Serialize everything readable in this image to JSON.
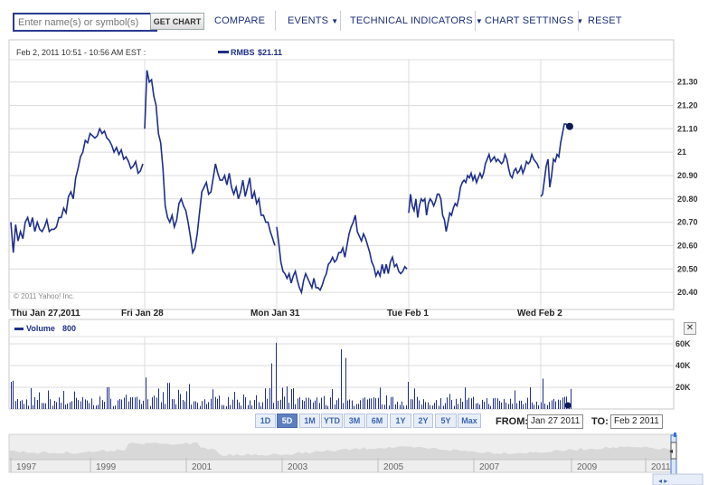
{
  "toolbar": {
    "search_placeholder": "Enter name(s) or symbol(s)",
    "get_chart": "GET CHART",
    "compare": "COMPARE",
    "events": "EVENTS",
    "technical_indicators": "TECHNICAL INDICATORS",
    "chart_settings": "CHART SETTINGS",
    "reset": "RESET",
    "dropdown_icon": "triangle-down-icon"
  },
  "header": {
    "datetime": "Feb 2, 2011 10:51 - 10:56 AM EST :",
    "symbol": "RMBS",
    "price": "$21.11"
  },
  "copyright": "© 2011 Yahoo! Inc.",
  "volume_label": "Volume",
  "volume_value": "800",
  "range_buttons": [
    "1D",
    "5D",
    "1M",
    "YTD",
    "3M",
    "6M",
    "1Y",
    "2Y",
    "5Y",
    "Max"
  ],
  "active_range": "5D",
  "from_label": "FROM:",
  "from_date": "Jan 27 2011",
  "to_label": "TO:",
  "to_date": "Feb 2 2011",
  "timeline_years": [
    "1997",
    "1999",
    "2001",
    "2003",
    "2005",
    "2007",
    "2009",
    "2011"
  ],
  "colors": {
    "line": "#1f2f8a",
    "volume": "#1f2f8a",
    "grid": "#dcdcdc",
    "active_button": "#5d7fbf"
  },
  "chart_data": [
    {
      "type": "line",
      "series": [
        {
          "name": "RMBS",
          "values": []
        }
      ],
      "x_tick_labels": [
        "Thu Jan 27,2011",
        "Fri Jan 28",
        "Mon Jan 31",
        "Tue Feb 1",
        "Wed Feb 2"
      ],
      "y_ticks": [
        "21.30",
        "21.20",
        "21.10",
        "21",
        "20.90",
        "20.80",
        "20.70",
        "20.60",
        "20.50",
        "20.40"
      ],
      "ylim": [
        20.35,
        21.38
      ],
      "grid": true,
      "sessions": [
        [
          20.7,
          20.57,
          20.69,
          20.62,
          20.66,
          20.63,
          20.7,
          20.72,
          20.68,
          20.72,
          20.66,
          20.7,
          20.67,
          20.66,
          20.68,
          20.71,
          20.66,
          20.67,
          20.67,
          20.68,
          20.72,
          20.72,
          20.76,
          20.74,
          20.81,
          20.83,
          20.8,
          20.89,
          20.93,
          20.98,
          21.0,
          21.05,
          21.04,
          21.08,
          21.07,
          21.06,
          21.07,
          21.1,
          21.08,
          21.09,
          21.06,
          21.05,
          21.03,
          21.0,
          21.02,
          20.99,
          21.01,
          20.97,
          20.98,
          20.96,
          20.93,
          20.94,
          20.96,
          20.91,
          20.92,
          20.95
        ],
        [
          21.1,
          21.35,
          21.3,
          21.31,
          21.24,
          21.2,
          21.08,
          21.04,
          20.93,
          20.77,
          20.72,
          20.7,
          20.73,
          20.68,
          20.71,
          20.78,
          20.8,
          20.77,
          20.75,
          20.7,
          20.64,
          20.57,
          20.59,
          20.65,
          20.74,
          20.83,
          20.85,
          20.87,
          20.82,
          20.83,
          20.89,
          20.95,
          20.91,
          20.88,
          20.88,
          20.9,
          20.86,
          20.91,
          20.85,
          20.82,
          20.85,
          20.8,
          20.83,
          20.88,
          20.81,
          20.85,
          20.89,
          20.8,
          20.83,
          20.78,
          20.8,
          20.73,
          20.73,
          20.7,
          20.7,
          20.66,
          20.63,
          20.6
        ],
        [
          20.68,
          20.61,
          20.53,
          20.49,
          20.48,
          20.46,
          20.48,
          20.44,
          20.47,
          20.49,
          20.45,
          20.42,
          20.4,
          20.45,
          20.48,
          20.46,
          20.44,
          20.42,
          20.46,
          20.42,
          20.42,
          20.41,
          20.43,
          20.46,
          20.48,
          20.52,
          20.53,
          20.55,
          20.53,
          20.54,
          20.57,
          20.57,
          20.59,
          20.55,
          20.6,
          20.65,
          20.68,
          20.7,
          20.73,
          20.66,
          20.64,
          20.62,
          20.65,
          20.63,
          20.6,
          20.57,
          20.53,
          20.51,
          20.47,
          20.49,
          20.47,
          20.52,
          20.48,
          20.52,
          20.48,
          20.53,
          20.55,
          20.51,
          20.52,
          20.49,
          20.48,
          20.49,
          20.51,
          20.5
        ],
        [
          20.74,
          20.82,
          20.77,
          20.75,
          20.8,
          20.72,
          20.77,
          20.8,
          20.79,
          20.8,
          20.73,
          20.78,
          20.8,
          20.79,
          20.77,
          20.79,
          20.82,
          20.82,
          20.8,
          20.73,
          20.71,
          20.66,
          20.7,
          20.74,
          20.73,
          20.76,
          20.78,
          20.77,
          20.8,
          20.85,
          20.87,
          20.88,
          20.87,
          20.9,
          20.89,
          20.91,
          20.88,
          20.9,
          20.87,
          20.89,
          20.91,
          20.89,
          20.91,
          20.95,
          20.97,
          20.99,
          20.96,
          20.97,
          20.98,
          20.96,
          20.97,
          20.96,
          20.95,
          20.96,
          20.99,
          20.97,
          20.93,
          20.9,
          20.89,
          20.92,
          20.93,
          20.91,
          20.92,
          20.94,
          20.91,
          20.93,
          20.96,
          20.95,
          20.96,
          20.99,
          20.97,
          20.96,
          20.95,
          20.93
        ],
        [
          20.81,
          20.82,
          20.88,
          20.94,
          20.97,
          20.85,
          20.9,
          20.97,
          20.96,
          20.99,
          20.98,
          21.04,
          21.08,
          21.12,
          21.12,
          21.11,
          21.11
        ]
      ]
    },
    {
      "type": "bar",
      "series": [
        {
          "name": "Volume",
          "values": []
        }
      ],
      "y_ticks": [
        "60K",
        "40K",
        "20K"
      ],
      "ylim": [
        0,
        65000
      ]
    }
  ]
}
